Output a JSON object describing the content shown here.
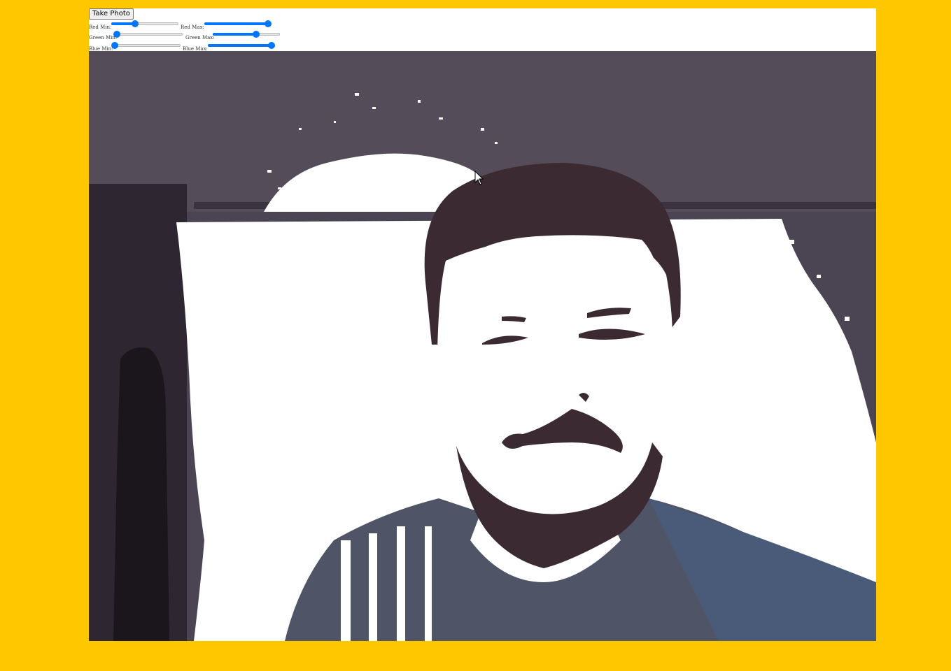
{
  "toolbar": {
    "take_photo_label": "Take Photo"
  },
  "sliders": [
    {
      "label": "Red Min:",
      "value": 0.35
    },
    {
      "label": "Red Max:",
      "value": 0.95
    },
    {
      "label": "Green Min:",
      "value": 0.02
    },
    {
      "label": "Green Max:",
      "value": 0.65
    },
    {
      "label": "Blue Min:",
      "value": 0.02
    },
    {
      "label": "Blue Max:",
      "value": 0.95
    }
  ],
  "colors": {
    "page_background": "#ffc700",
    "slider_accent": "#0075ff",
    "masked_white": "#ffffff",
    "wall_dark": "#4a4350"
  },
  "icons": {
    "cursor": "mouse-pointer-icon"
  }
}
